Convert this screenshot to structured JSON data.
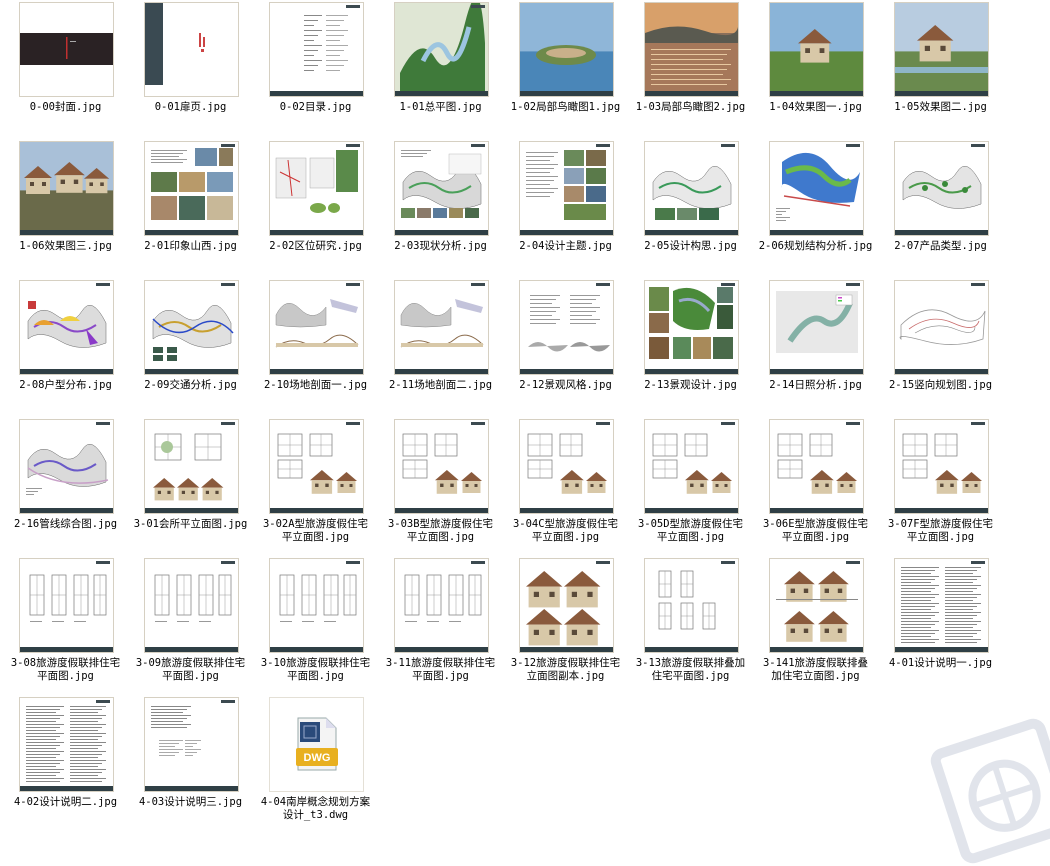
{
  "files": [
    {
      "name": "0-00封面.jpg",
      "kind": "dark"
    },
    {
      "name": "0-01扉页.jpg",
      "kind": "title"
    },
    {
      "name": "0-02目录.jpg",
      "kind": "toc"
    },
    {
      "name": "1-01总平图.jpg",
      "kind": "aerial-green"
    },
    {
      "name": "1-02局部鸟瞰图1.jpg",
      "kind": "aerial-lake"
    },
    {
      "name": "1-03局部鸟瞰图2.jpg",
      "kind": "aerial-dusk"
    },
    {
      "name": "1-04效果图一.jpg",
      "kind": "render-villa"
    },
    {
      "name": "1-05效果图二.jpg",
      "kind": "render-villa2"
    },
    {
      "name": "1-06效果图三.jpg",
      "kind": "render-town"
    },
    {
      "name": "2-01印象山西.jpg",
      "kind": "photo-board"
    },
    {
      "name": "2-02区位研究.jpg",
      "kind": "location"
    },
    {
      "name": "2-03现状分析.jpg",
      "kind": "analysis"
    },
    {
      "name": "2-04设计主题.jpg",
      "kind": "photo-board2"
    },
    {
      "name": "2-05设计构思.jpg",
      "kind": "concept"
    },
    {
      "name": "2-06规划结构分析.jpg",
      "kind": "structure"
    },
    {
      "name": "2-07产品类型.jpg",
      "kind": "product"
    },
    {
      "name": "2-08户型分布.jpg",
      "kind": "distribution"
    },
    {
      "name": "2-09交通分析.jpg",
      "kind": "traffic"
    },
    {
      "name": "2-10场地剖面一.jpg",
      "kind": "section"
    },
    {
      "name": "2-11场地剖面二.jpg",
      "kind": "section"
    },
    {
      "name": "2-12景观风格.jpg",
      "kind": "landscape-style"
    },
    {
      "name": "2-13景观设计.jpg",
      "kind": "landscape"
    },
    {
      "name": "2-14日照分析.jpg",
      "kind": "sunlight"
    },
    {
      "name": "2-15竖向规划图.jpg",
      "kind": "vertical"
    },
    {
      "name": "2-16管线综合图.jpg",
      "kind": "pipeline"
    },
    {
      "name": "3-01会所平立面图.jpg",
      "kind": "clubhouse"
    },
    {
      "name": "3-02A型旅游度假住宅\n平立面图.jpg",
      "kind": "house-plan"
    },
    {
      "name": "3-03B型旅游度假住宅\n平立面图.jpg",
      "kind": "house-plan"
    },
    {
      "name": "3-04C型旅游度假住宅\n平立面图.jpg",
      "kind": "house-plan"
    },
    {
      "name": "3-05D型旅游度假住宅\n平立面图.jpg",
      "kind": "house-plan"
    },
    {
      "name": "3-06E型旅游度假住宅\n平立面图.jpg",
      "kind": "house-plan"
    },
    {
      "name": "3-07F型旅游度假住宅\n平立面图.jpg",
      "kind": "house-plan"
    },
    {
      "name": "3-08旅游度假联排住宅\n平面图.jpg",
      "kind": "row-plan"
    },
    {
      "name": "3-09旅游度假联排住宅\n平面图.jpg",
      "kind": "row-plan"
    },
    {
      "name": "3-10旅游度假联排住宅\n平面图.jpg",
      "kind": "row-plan"
    },
    {
      "name": "3-11旅游度假联排住宅\n平面图.jpg",
      "kind": "row-plan"
    },
    {
      "name": "3-12旅游度假联排住宅\n立面图副本.jpg",
      "kind": "elevation"
    },
    {
      "name": "3-13旅游度假联排叠加\n住宅平面图.jpg",
      "kind": "row-plan2"
    },
    {
      "name": "3-141旅游度假联排叠\n加住宅立面图.jpg",
      "kind": "elevation2"
    },
    {
      "name": "4-01设计说明一.jpg",
      "kind": "text"
    },
    {
      "name": "4-02设计说明二.jpg",
      "kind": "text"
    },
    {
      "name": "4-03设计说明三.jpg",
      "kind": "text-sparse"
    },
    {
      "name": "4-04南岸概念规划方案\n设计_t3.dwg",
      "kind": "dwg"
    }
  ],
  "dwg_badge": "DWG",
  "icons": {
    "dwg": "dwg-file-icon",
    "watermark": "watermark-logo"
  }
}
